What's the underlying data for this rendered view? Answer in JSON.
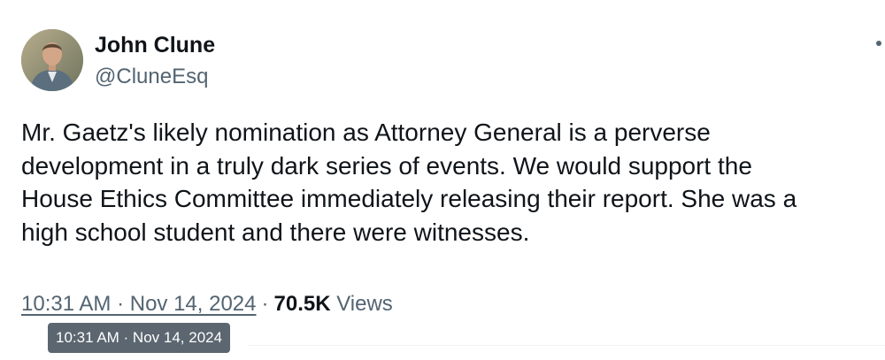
{
  "author": {
    "display_name": "John Clune",
    "handle": "@CluneEsq"
  },
  "tweet": {
    "text_lines": [
      "Mr. Gaetz's likely nomination as Attorney General is a perverse",
      "development in a truly dark series of events. We would support the",
      "House Ethics Committee immediately releasing their report. She was a",
      "high school student and there were witnesses."
    ]
  },
  "meta": {
    "timestamp": "10:31 AM · Nov 14, 2024",
    "separator": "·",
    "views_count": "70.5K",
    "views_label": "Views"
  },
  "tooltip": {
    "text": "10:31 AM · Nov 14, 2024"
  },
  "icons": {
    "more": "more-options-icon"
  }
}
